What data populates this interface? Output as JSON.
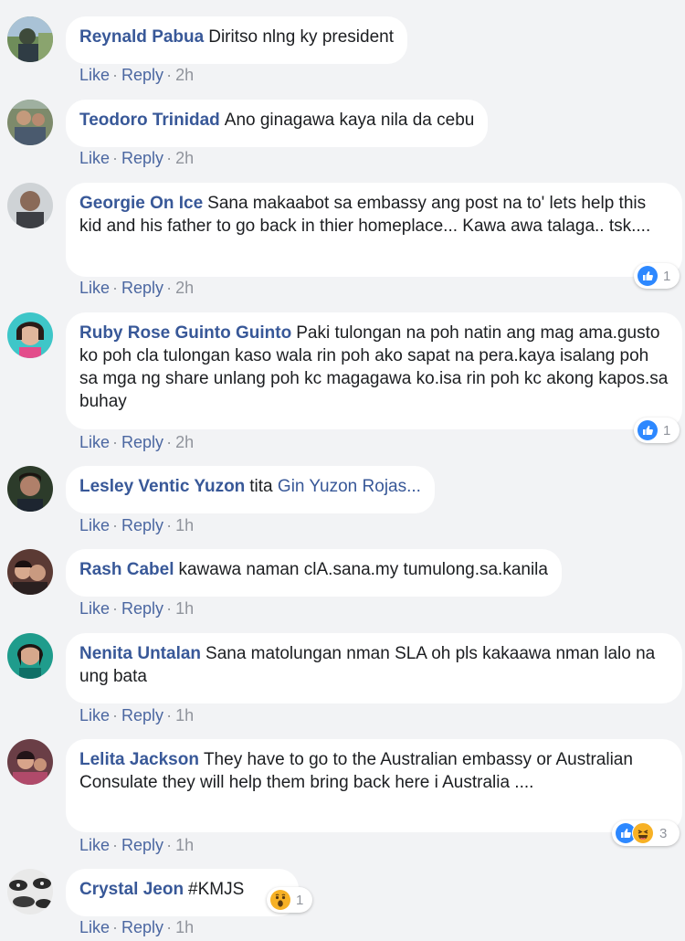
{
  "colors": {
    "background": "#f2f3f5",
    "bubble": "#ffffff",
    "author": "#385898",
    "meta": "#90949c",
    "like_blue": "#2d88ff"
  },
  "actions": {
    "like": "Like",
    "reply": "Reply",
    "separator": "·"
  },
  "comments": [
    {
      "author": "Reynald Pabua",
      "text": "Diritso nlng ky president",
      "time": "2h"
    },
    {
      "author": "Teodoro Trinidad",
      "text": "Ano ginagawa kaya nila da cebu",
      "time": "2h"
    },
    {
      "author": "Georgie On Ice",
      "text": "Sana makaabot sa embassy ang post na to' lets help this kid and his father to go back in thier homeplace... Kawa awa talaga.. tsk....",
      "time": "2h",
      "reactions": {
        "icons": [
          "like-icon"
        ],
        "count": "1"
      }
    },
    {
      "author": "Ruby Rose Guinto Guinto",
      "text": "Paki tulongan na poh natin ang mag ama.gusto ko poh cla tulongan kaso wala rin poh ako sapat na pera.kaya isalang poh sa mga ng share unlang poh kc magagawa ko.isa rin poh kc akong kapos.sa buhay",
      "time": "2h",
      "reactions": {
        "icons": [
          "like-icon"
        ],
        "count": "1"
      }
    },
    {
      "author": "Lesley Ventic Yuzon",
      "text": "tita",
      "mention": "Gin Yuzon Rojas...",
      "time": "1h"
    },
    {
      "author": "Rash Cabel",
      "text": "kawawa naman clA.sana.my tumulong.sa.kanila",
      "time": "1h"
    },
    {
      "author": "Nenita Untalan",
      "text": "Sana matolungan nman SLA oh pls kakaawa nman lalo na ung bata",
      "time": "1h"
    },
    {
      "author": "Lelita Jackson",
      "text": "They have to go to the Australian embassy or Australian Consulate they will help them bring back here i Australia ....",
      "time": "1h",
      "reactions": {
        "icons": [
          "like-icon",
          "haha-icon"
        ],
        "count": "3"
      }
    },
    {
      "author": "Crystal Jeon",
      "text": "#KMJS",
      "time": "1h",
      "reactions": {
        "icons": [
          "wow-icon"
        ],
        "count": "1"
      }
    }
  ]
}
